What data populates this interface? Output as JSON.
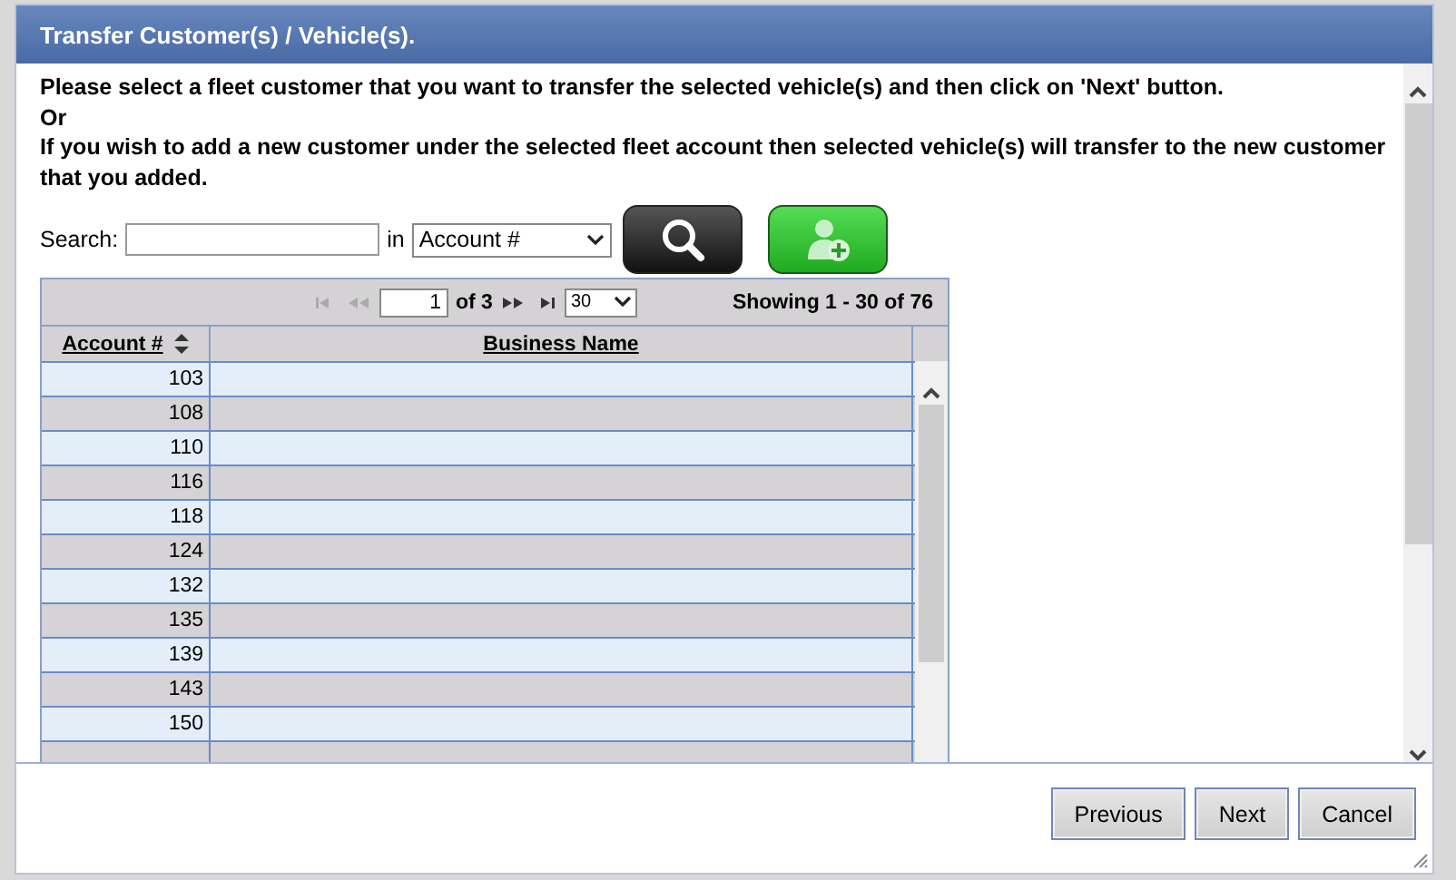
{
  "dialog": {
    "title": "Transfer Customer(s) / Vehicle(s)."
  },
  "instructions": [
    "Please select a fleet customer that you want to transfer the selected vehicle(s) and then click on 'Next' button.",
    "Or",
    "If you wish to add a new customer under the selected fleet account then selected vehicle(s) will transfer to the new customer that you added."
  ],
  "search": {
    "label": "Search:",
    "in_label": "in",
    "field": "Account #"
  },
  "pager": {
    "back_disabled": true,
    "forward_disabled": false,
    "page": "1",
    "of": "of 3",
    "page_size": "30",
    "showing": "Showing 1 - 30 of 76"
  },
  "table": {
    "columns": [
      {
        "label": "Account #",
        "sortable": true
      },
      {
        "label": "Business Name",
        "sortable": false
      }
    ],
    "rows": [
      {
        "account": "103"
      },
      {
        "account": "108"
      },
      {
        "account": "110"
      },
      {
        "account": "116"
      },
      {
        "account": "118"
      },
      {
        "account": "124"
      },
      {
        "account": "132"
      },
      {
        "account": "135"
      },
      {
        "account": "139"
      },
      {
        "account": "143"
      },
      {
        "account": "150"
      }
    ]
  },
  "buttons": [
    "Previous",
    "Next",
    "Cancel"
  ]
}
